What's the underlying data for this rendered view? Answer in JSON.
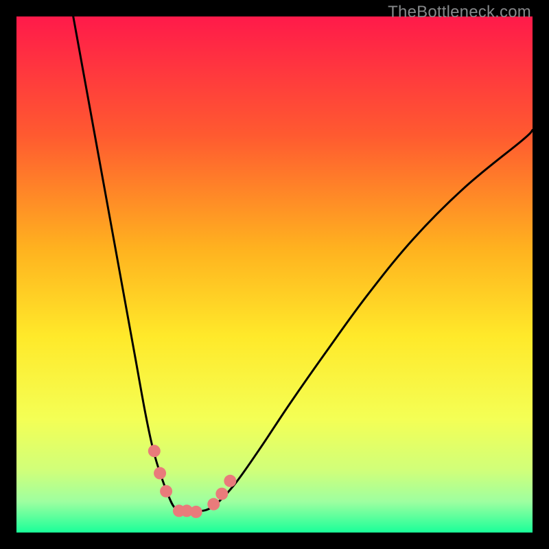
{
  "watermark": "TheBottleneck.com",
  "chart_data": {
    "type": "line",
    "title": "",
    "xlabel": "",
    "ylabel": "",
    "xlim": [
      0,
      100
    ],
    "ylim": [
      0,
      100
    ],
    "grid": false,
    "legend": false,
    "background_gradient": {
      "top": "#ff1a4a",
      "mid_upper": "#ff8a2a",
      "mid": "#ffe92a",
      "mid_lower": "#e6ff66",
      "bottom": "#1aff99"
    },
    "series": [
      {
        "name": "left-curve",
        "color": "#000000",
        "x": [
          11,
          13,
          15,
          17,
          19,
          21,
          23,
          25,
          26.5,
          28,
          29.5,
          30.5,
          31.7,
          33
        ],
        "y": [
          100,
          89,
          78,
          67,
          56,
          45,
          34,
          23,
          16,
          11,
          7,
          5,
          4,
          4.3
        ]
      },
      {
        "name": "right-curve",
        "color": "#000000",
        "x": [
          33,
          35,
          38,
          42,
          47,
          53,
          60,
          68,
          77,
          87,
          98,
          100
        ],
        "y": [
          4.3,
          4.1,
          5,
          9,
          16,
          25,
          35,
          46,
          57,
          67,
          76,
          78
        ]
      }
    ],
    "markers": [
      {
        "name": "marker-left-1",
        "x": 26.7,
        "y": 15.8
      },
      {
        "name": "marker-left-2",
        "x": 27.8,
        "y": 11.5
      },
      {
        "name": "marker-left-3",
        "x": 29.0,
        "y": 8.0
      },
      {
        "name": "marker-bottom-1",
        "x": 31.5,
        "y": 4.2
      },
      {
        "name": "marker-bottom-2",
        "x": 33.0,
        "y": 4.2
      },
      {
        "name": "marker-bottom-3",
        "x": 34.8,
        "y": 4.0
      },
      {
        "name": "marker-right-1",
        "x": 38.2,
        "y": 5.5
      },
      {
        "name": "marker-right-2",
        "x": 39.8,
        "y": 7.5
      },
      {
        "name": "marker-right-3",
        "x": 41.4,
        "y": 10.0
      }
    ],
    "marker_style": {
      "color": "#e97b7b",
      "radius_px": 9
    }
  }
}
